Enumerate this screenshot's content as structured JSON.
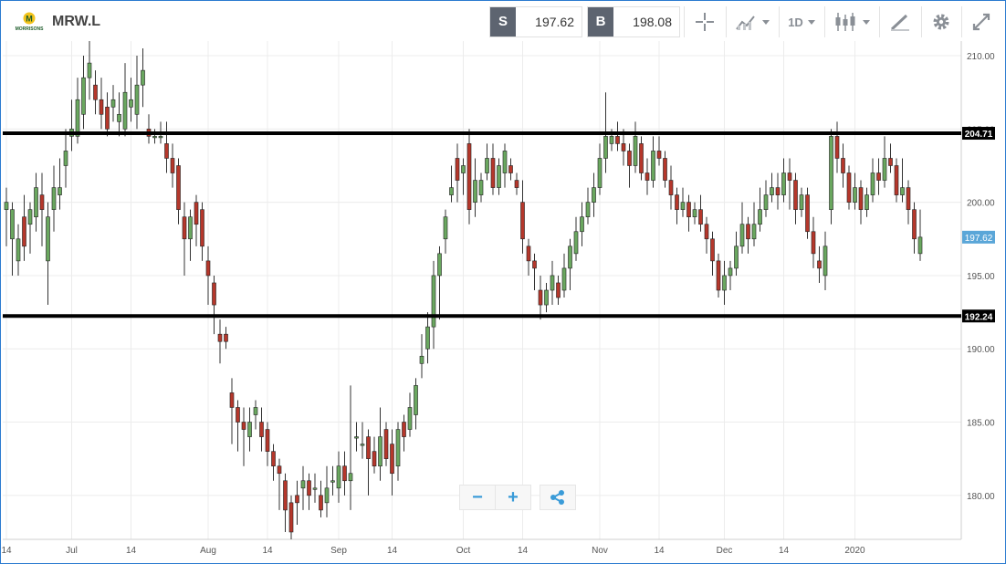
{
  "instrument": {
    "symbol": "MRW.L",
    "logo_text": "MORRISONS",
    "logo_letter": "M"
  },
  "toolbar": {
    "sell_label": "S",
    "sell_price": "197.62",
    "buy_label": "B",
    "buy_price": "198.08",
    "timeframe_label": "1D",
    "icons": [
      "crosshair-icon",
      "compare-icon",
      "candlestick-type-icon",
      "drawing-icon",
      "settings-icon",
      "fullscreen-icon"
    ]
  },
  "controls": {
    "zoom_out": "−",
    "zoom_in": "+",
    "share_icon": "share-icon"
  },
  "colors": {
    "up": "#6aa75f",
    "down": "#b5372b",
    "current_price_bg": "#5aa6d8",
    "level_line": "#000000",
    "frame": "#2b7bd0"
  },
  "chart_data": {
    "type": "candlestick",
    "ylim": [
      177,
      211
    ],
    "y_ticks": [
      180,
      185,
      190,
      195,
      200,
      205,
      210
    ],
    "y_tick_labels": [
      "180.00",
      "185.00",
      "190.00",
      "195.00",
      "200.00",
      "205.00",
      "210.00"
    ],
    "x_tick_labels": [
      {
        "index": 0,
        "label": "14"
      },
      {
        "index": 11,
        "label": "Jul"
      },
      {
        "index": 21,
        "label": "14"
      },
      {
        "index": 34,
        "label": "Aug"
      },
      {
        "index": 44,
        "label": "14"
      },
      {
        "index": 56,
        "label": "Sep"
      },
      {
        "index": 65,
        "label": "14"
      },
      {
        "index": 77,
        "label": "Oct"
      },
      {
        "index": 87,
        "label": "14"
      },
      {
        "index": 100,
        "label": "Nov"
      },
      {
        "index": 110,
        "label": "14"
      },
      {
        "index": 121,
        "label": "Dec"
      },
      {
        "index": 131,
        "label": "14"
      },
      {
        "index": 143,
        "label": "2020"
      }
    ],
    "horizontal_levels": [
      {
        "value": 204.71,
        "label": "204.71"
      },
      {
        "value": 192.24,
        "label": "192.24"
      }
    ],
    "current_price": {
      "value": 197.62,
      "label": "197.62"
    },
    "grid": true,
    "candles": [
      [
        199.5,
        200,
        201,
        197
      ],
      [
        197.5,
        199.5,
        200,
        195
      ],
      [
        196,
        197.5,
        198.5,
        195
      ],
      [
        199,
        197,
        200.5,
        196
      ],
      [
        198.5,
        199.5,
        200,
        196.5
      ],
      [
        199,
        201,
        202,
        198
      ],
      [
        200.5,
        199.5,
        202,
        197
      ],
      [
        196,
        199,
        200,
        193
      ],
      [
        199.5,
        201,
        202.5,
        198
      ],
      [
        200.5,
        201,
        203,
        199.5
      ],
      [
        202.5,
        203.5,
        205,
        201
      ],
      [
        204.5,
        205,
        207,
        203.5
      ],
      [
        204.5,
        207,
        208.5,
        204
      ],
      [
        206,
        208.5,
        210,
        205
      ],
      [
        208.5,
        209.5,
        211,
        207
      ],
      [
        208,
        207,
        209,
        206
      ],
      [
        207,
        206,
        208.5,
        205
      ],
      [
        206.5,
        205,
        207.5,
        204.5
      ],
      [
        206.5,
        207,
        208,
        205.5
      ],
      [
        205.5,
        206,
        207.5,
        204.5
      ],
      [
        205,
        207.5,
        209.5,
        204.5
      ],
      [
        206.5,
        207,
        208.5,
        205.5
      ],
      [
        206,
        208,
        210,
        205
      ],
      [
        208,
        209,
        210.5,
        206.5
      ],
      [
        205,
        204.5,
        206,
        204
      ],
      [
        204.5,
        204.5,
        205,
        204
      ],
      [
        204.5,
        204.5,
        205.5,
        204
      ],
      [
        204,
        203,
        205.5,
        202
      ],
      [
        203,
        202,
        204,
        201
      ],
      [
        202.5,
        199.5,
        203,
        198.5
      ],
      [
        199,
        197.5,
        200,
        195
      ],
      [
        197.5,
        199,
        199.5,
        196
      ],
      [
        200,
        198.5,
        200.5,
        197
      ],
      [
        199.5,
        197,
        200,
        196
      ],
      [
        196,
        195,
        197,
        193
      ],
      [
        194.5,
        193,
        195,
        191
      ],
      [
        191,
        190.5,
        192,
        189
      ],
      [
        191,
        190.5,
        191.5,
        190
      ],
      [
        187,
        186,
        188,
        183.5
      ],
      [
        186,
        185,
        186.5,
        183
      ],
      [
        185,
        184.5,
        186,
        182
      ],
      [
        184,
        185,
        186,
        183
      ],
      [
        185.5,
        186,
        186.5,
        184.5
      ],
      [
        185,
        184,
        186,
        183
      ],
      [
        184.5,
        183,
        185,
        182
      ],
      [
        183,
        182,
        183.5,
        181
      ],
      [
        182,
        181.5,
        182.5,
        179
      ],
      [
        181,
        179,
        181.5,
        177.5
      ],
      [
        179.5,
        177.5,
        180,
        177
      ],
      [
        180,
        179.5,
        181,
        178
      ],
      [
        180.5,
        181,
        182,
        179
      ],
      [
        181,
        180,
        181.5,
        179
      ],
      [
        180.5,
        180.5,
        181.5,
        179.5
      ],
      [
        180,
        179,
        181,
        178.5
      ],
      [
        179.5,
        180.5,
        182,
        178.5
      ],
      [
        181,
        181,
        182,
        180
      ],
      [
        180.5,
        182,
        183,
        179.5
      ],
      [
        182,
        181,
        183,
        180
      ],
      [
        181,
        181.5,
        187.5,
        179
      ],
      [
        184,
        184,
        185,
        183
      ],
      [
        183.5,
        183.5,
        185,
        182.5
      ],
      [
        184,
        182.5,
        184.5,
        180
      ],
      [
        183,
        182,
        184,
        181.5
      ],
      [
        182,
        184,
        186,
        181
      ],
      [
        184.5,
        182.5,
        185,
        182
      ],
      [
        183.5,
        181.5,
        184.5,
        180
      ],
      [
        182,
        184.5,
        185,
        181
      ],
      [
        185,
        184,
        185.5,
        183
      ],
      [
        184.5,
        186,
        187,
        184
      ],
      [
        185.5,
        187.5,
        188,
        184.5
      ],
      [
        189,
        189.5,
        191,
        188
      ],
      [
        190,
        191.5,
        192.5,
        189
      ],
      [
        191.5,
        195,
        196,
        190
      ],
      [
        195,
        196.5,
        197,
        192
      ],
      [
        197.5,
        199,
        199.5,
        196.5
      ],
      [
        200.5,
        201,
        202.5,
        200
      ],
      [
        203,
        201.5,
        204,
        200
      ],
      [
        202,
        202.5,
        203,
        200.5
      ],
      [
        204,
        199.5,
        205,
        198.5
      ],
      [
        200,
        201.5,
        203,
        199
      ],
      [
        200.5,
        201.5,
        202,
        200
      ],
      [
        202,
        203,
        204,
        201.5
      ],
      [
        203,
        201,
        204,
        200.5
      ],
      [
        201,
        202.5,
        203,
        200.5
      ],
      [
        202,
        203.5,
        204,
        201
      ],
      [
        202.5,
        202,
        203,
        201.5
      ],
      [
        201.5,
        201,
        202,
        200.5
      ],
      [
        200,
        197.5,
        201.5,
        196.5
      ],
      [
        197,
        196,
        197.5,
        195
      ],
      [
        196,
        195.5,
        196.5,
        194
      ],
      [
        194,
        193,
        195,
        192
      ],
      [
        193,
        194,
        194.5,
        192.5
      ],
      [
        194,
        195,
        196,
        193
      ],
      [
        194.5,
        193.5,
        195,
        193
      ],
      [
        194,
        195.5,
        196.5,
        193.5
      ],
      [
        195.5,
        197,
        197.5,
        194
      ],
      [
        196.5,
        198,
        199,
        196
      ],
      [
        198,
        199,
        200,
        197
      ],
      [
        199,
        200,
        201,
        198.5
      ],
      [
        200,
        201,
        202,
        199
      ],
      [
        201,
        203,
        204,
        200.5
      ],
      [
        203,
        204.5,
        207.5,
        202
      ],
      [
        204,
        204.5,
        205,
        203.5
      ],
      [
        204.5,
        204,
        205.5,
        203.5
      ],
      [
        204,
        203.5,
        205,
        202.5
      ],
      [
        203.5,
        202.5,
        204,
        201
      ],
      [
        202.5,
        204.5,
        205.5,
        202
      ],
      [
        204,
        202,
        204.5,
        201.5
      ],
      [
        202,
        201.5,
        203,
        200.5
      ],
      [
        201.5,
        203.5,
        204.5,
        201
      ],
      [
        203.5,
        203,
        204.5,
        202.5
      ],
      [
        203,
        201.5,
        203.5,
        201
      ],
      [
        201.5,
        200.5,
        202.5,
        199.5
      ],
      [
        200.5,
        199.5,
        201,
        198.5
      ],
      [
        199.5,
        200,
        201,
        199
      ],
      [
        200,
        199,
        200.5,
        198
      ],
      [
        199,
        199.5,
        200,
        198.5
      ],
      [
        199.5,
        198.5,
        200.5,
        198
      ],
      [
        198.5,
        197.5,
        199,
        196.5
      ],
      [
        197.5,
        196,
        198,
        195
      ],
      [
        196,
        194,
        196.5,
        193.5
      ],
      [
        194,
        195,
        196,
        193
      ],
      [
        195,
        195.5,
        196,
        194
      ],
      [
        195.5,
        197,
        198,
        195
      ],
      [
        197,
        198.5,
        200,
        196.5
      ],
      [
        198.5,
        197.5,
        199,
        196.5
      ],
      [
        197.5,
        198.5,
        200,
        197
      ],
      [
        198.5,
        199.5,
        201,
        198
      ],
      [
        199.5,
        200.5,
        201.5,
        199
      ],
      [
        200.5,
        201,
        202,
        200
      ],
      [
        201,
        200.5,
        202,
        199.5
      ],
      [
        200.5,
        202,
        203,
        200
      ],
      [
        202,
        201.5,
        203,
        199.5
      ],
      [
        201.5,
        199.5,
        202,
        198.5
      ],
      [
        199.5,
        200.5,
        201,
        199
      ],
      [
        200.5,
        198,
        201,
        197.5
      ],
      [
        198,
        196.5,
        199,
        195.5
      ],
      [
        196,
        195.5,
        197,
        194.5
      ],
      [
        195,
        197,
        198,
        194
      ],
      [
        199.5,
        204.5,
        205,
        198.5
      ],
      [
        204.5,
        203,
        205.5,
        202
      ],
      [
        203,
        202,
        204,
        201
      ],
      [
        202,
        200,
        202.5,
        199.5
      ],
      [
        200,
        201,
        202,
        199.5
      ],
      [
        201,
        199.5,
        201.5,
        198.5
      ],
      [
        199.5,
        200.5,
        201,
        199
      ],
      [
        200.5,
        202,
        203,
        200
      ],
      [
        202,
        201.5,
        203,
        200.5
      ],
      [
        201.5,
        203,
        204.5,
        201
      ],
      [
        203,
        202.5,
        204,
        202
      ],
      [
        202.5,
        200.5,
        203,
        200
      ],
      [
        200.5,
        201,
        203,
        200
      ],
      [
        201,
        199.5,
        201.5,
        198.5
      ],
      [
        199.5,
        197.5,
        200,
        196.5
      ],
      [
        196.5,
        197.62,
        199.5,
        196
      ]
    ]
  }
}
